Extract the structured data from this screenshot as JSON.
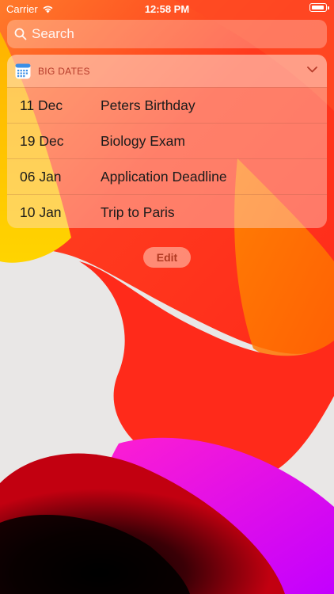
{
  "status_bar": {
    "carrier": "Carrier",
    "time": "12:58 PM"
  },
  "search": {
    "placeholder": "Search"
  },
  "widget": {
    "title": "BIG DATES",
    "accent_color": "#b63b2a",
    "items": [
      {
        "date": "11 Dec",
        "title": "Peters Birthday"
      },
      {
        "date": "19 Dec",
        "title": "Biology Exam"
      },
      {
        "date": "06 Jan",
        "title": "Application Deadline"
      },
      {
        "date": "10 Jan",
        "title": "Trip to Paris"
      }
    ]
  },
  "edit_button": {
    "label": "Edit"
  }
}
